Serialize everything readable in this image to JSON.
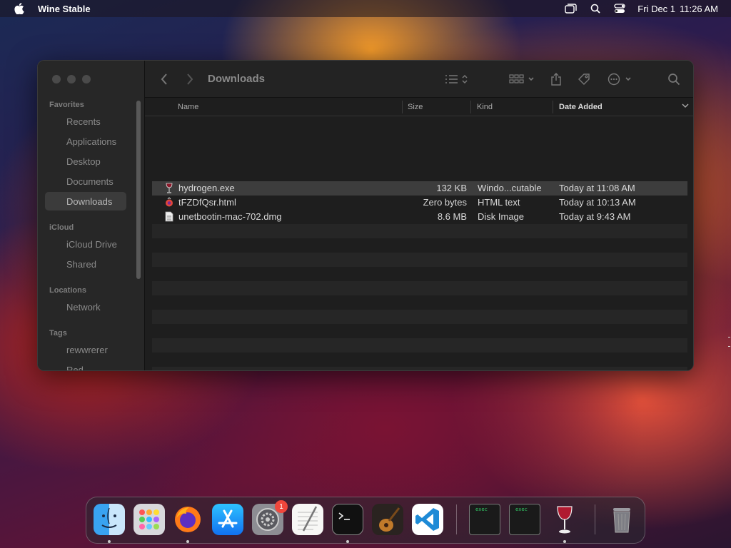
{
  "menubar": {
    "app_name": "Wine Stable",
    "date": "Fri Dec 1",
    "time": "11:26 AM"
  },
  "finder": {
    "title": "Downloads",
    "sidebar": {
      "sections": [
        {
          "label": "Favorites",
          "items": [
            "Recents",
            "Applications",
            "Desktop",
            "Documents",
            "Downloads"
          ]
        },
        {
          "label": "iCloud",
          "items": [
            "iCloud Drive",
            "Shared"
          ]
        },
        {
          "label": "Locations",
          "items": [
            "Network"
          ]
        },
        {
          "label": "Tags",
          "items": [
            "rewwrerer",
            "Red"
          ]
        }
      ],
      "active": "Downloads"
    },
    "columns": {
      "name": "Name",
      "size": "Size",
      "kind": "Kind",
      "date_added": "Date Added"
    },
    "files": [
      {
        "name": "hydrogen.exe",
        "size": "132 KB",
        "kind": "Windo...cutable",
        "date_added": "Today at 11:08 AM",
        "icon": "wine-glass-icon",
        "selected": true
      },
      {
        "name": "tFZDfQsr.html",
        "size": "Zero bytes",
        "kind": "HTML text",
        "date_added": "Today at 10:13 AM",
        "icon": "html-file-icon",
        "selected": false
      },
      {
        "name": "unetbootin-mac-702.dmg",
        "size": "8.6 MB",
        "kind": "Disk Image",
        "date_added": "Today at 9:43 AM",
        "icon": "disk-image-icon",
        "selected": false
      }
    ]
  },
  "dock": {
    "items": [
      "Finder",
      "Launchpad",
      "Firefox",
      "App Store",
      "System Settings",
      "TextEdit",
      "Terminal",
      "GarageBand",
      "Visual Studio Code",
      "exec",
      "exec",
      "Wine",
      "Trash"
    ],
    "exec_label": "exec",
    "settings_badge": "1"
  }
}
